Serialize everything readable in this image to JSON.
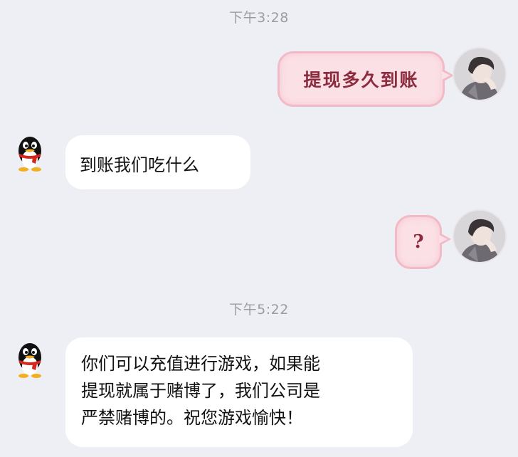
{
  "timestamps": [
    "下午3:28",
    "下午5:22"
  ],
  "messages": [
    {
      "side": "right",
      "sender": "user",
      "text": "提现多久到账",
      "avatar": "user-photo-avatar"
    },
    {
      "side": "left",
      "sender": "service",
      "text": "到账我们吃什么",
      "avatar": "qq-penguin-icon"
    },
    {
      "side": "right",
      "sender": "user",
      "text": "?",
      "avatar": "user-photo-avatar"
    },
    {
      "side": "left",
      "sender": "service",
      "lines": [
        "你们可以充值进行游戏，如果能",
        "提现就属于赌博了，我们公司是",
        "严禁赌博的。祝您游戏愉快！"
      ],
      "avatar": "qq-penguin-icon"
    }
  ],
  "colors": {
    "background": "#eeeff4",
    "user_bubble_fill": "#fbe1e6",
    "user_bubble_border": "#f2b9c6",
    "user_bubble_text": "#8d2b3e",
    "service_bubble_fill": "#ffffff",
    "timestamp_text": "#9a9ca3"
  }
}
